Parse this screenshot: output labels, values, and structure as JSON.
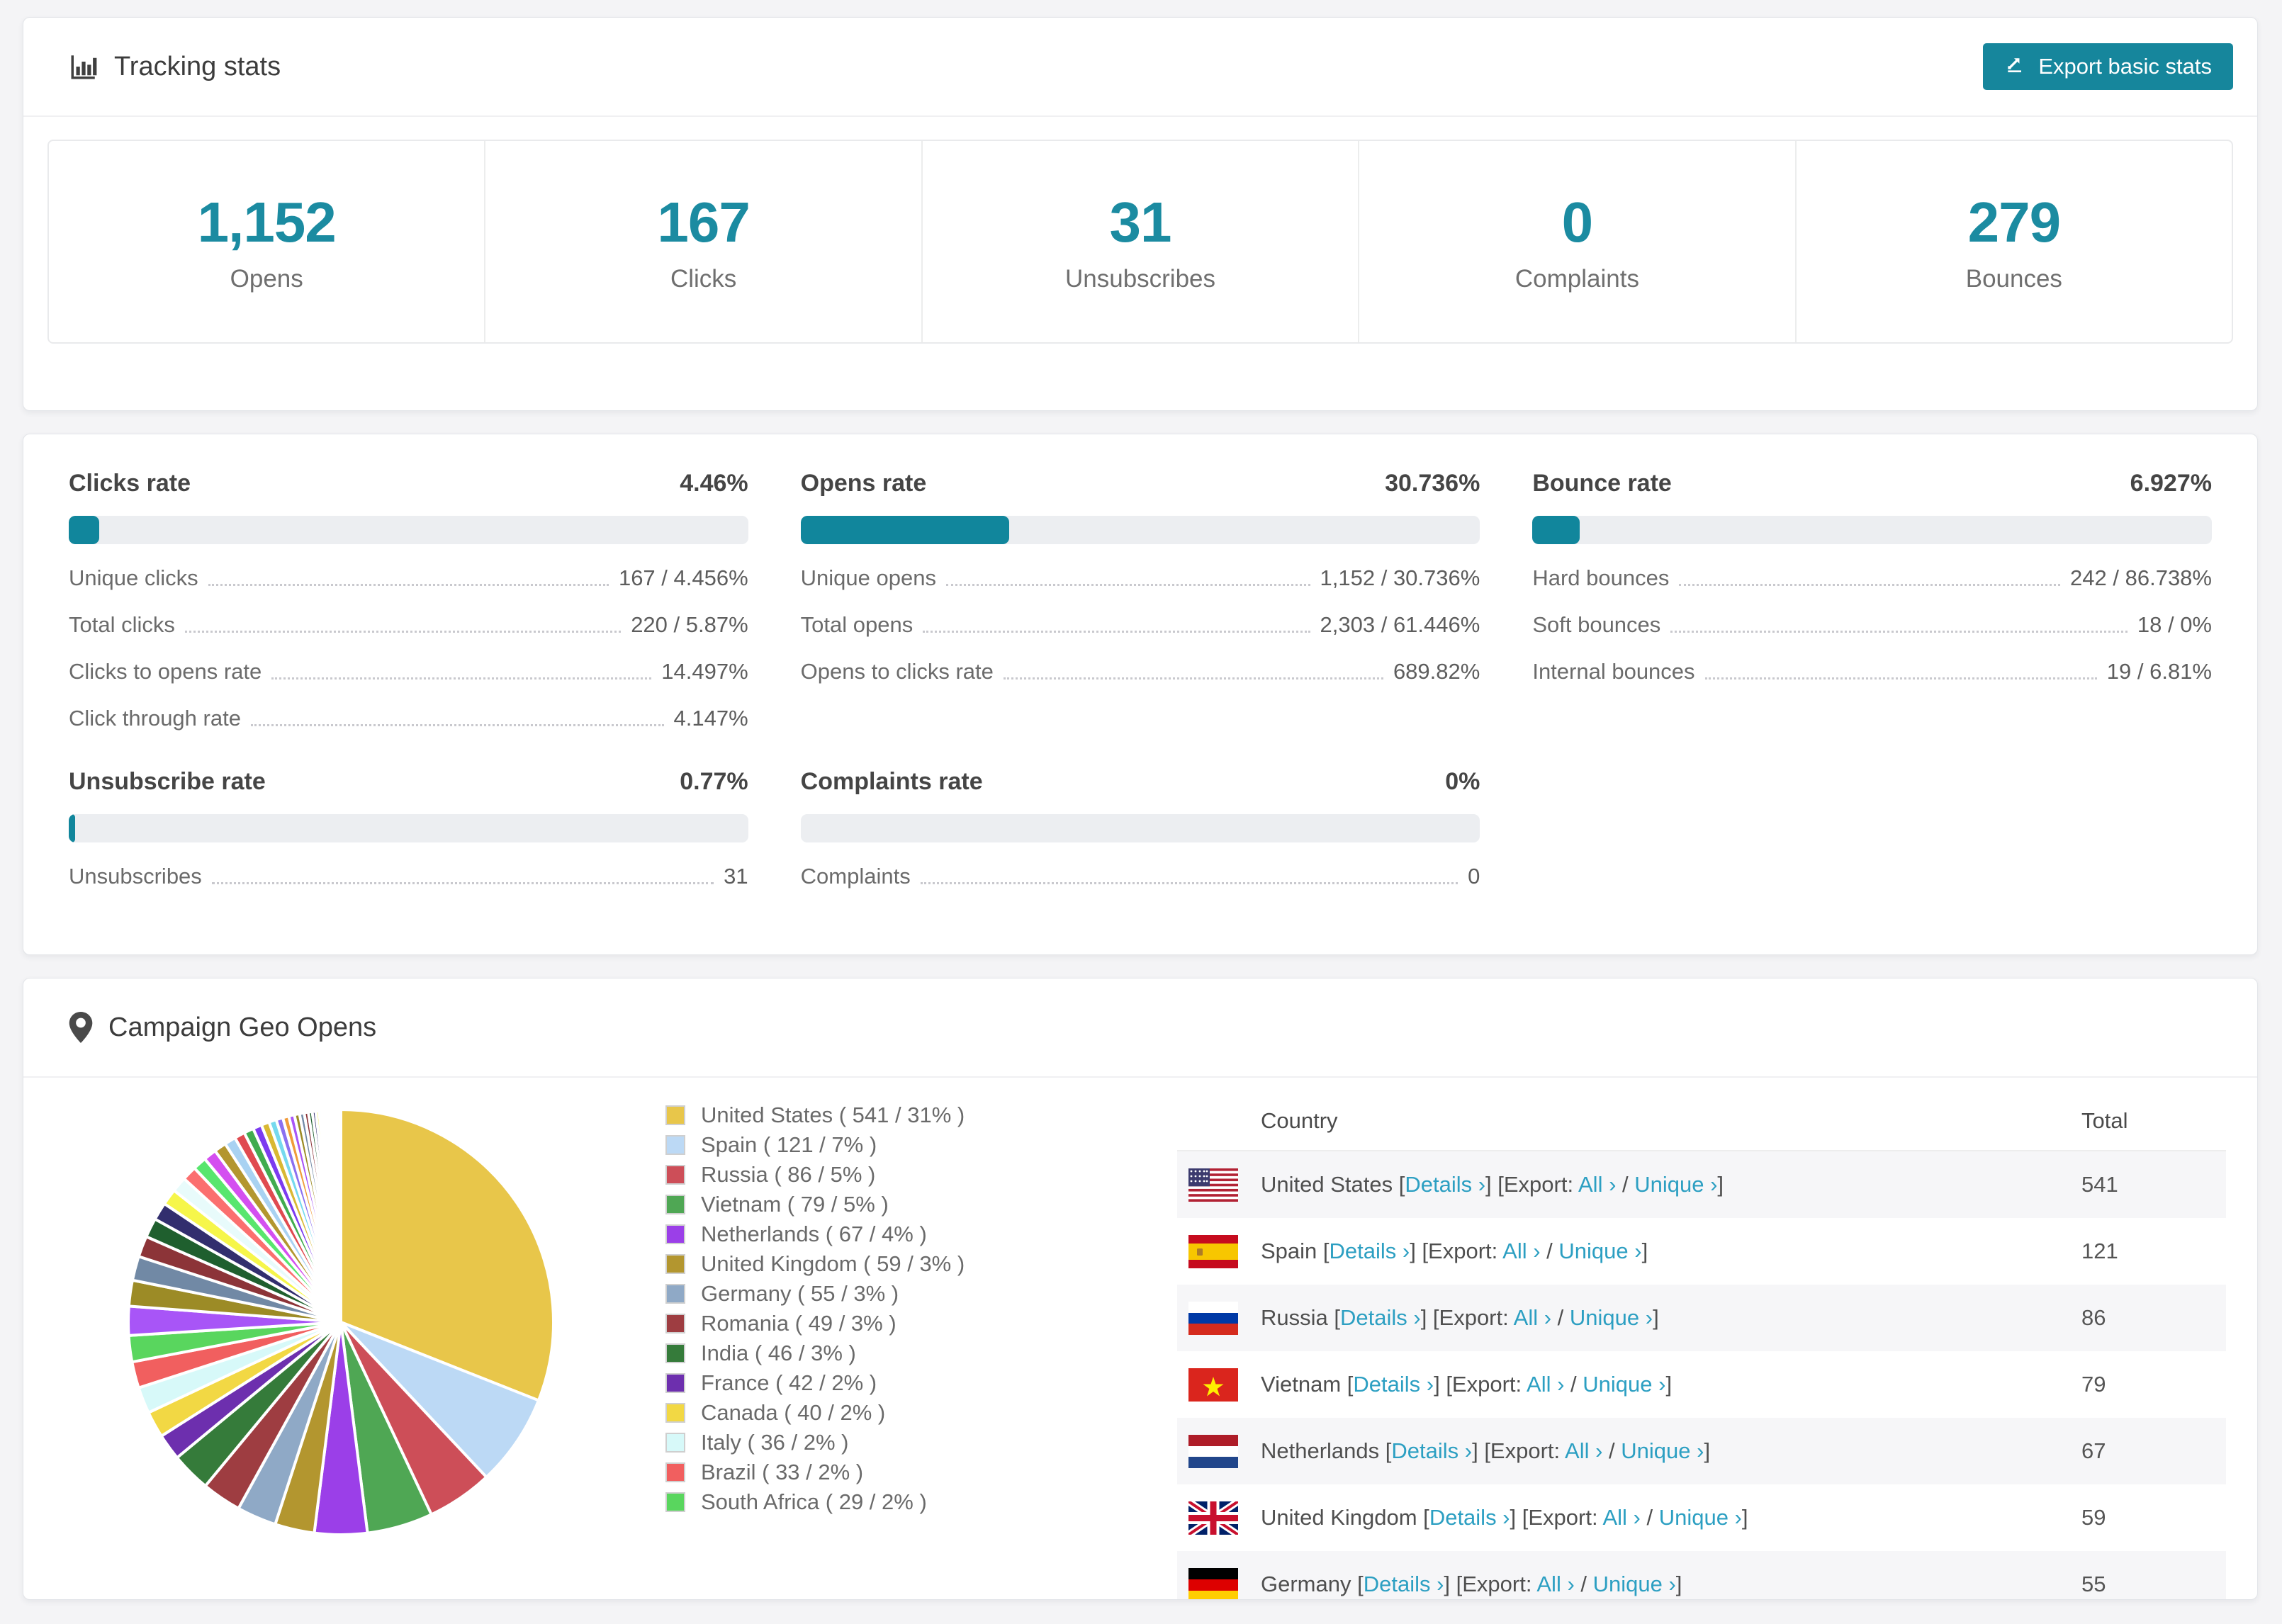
{
  "tracking": {
    "title": "Tracking stats",
    "export_button": "Export basic stats",
    "summary": [
      {
        "value": "1,152",
        "label": "Opens"
      },
      {
        "value": "167",
        "label": "Clicks"
      },
      {
        "value": "31",
        "label": "Unsubscribes"
      },
      {
        "value": "0",
        "label": "Complaints"
      },
      {
        "value": "279",
        "label": "Bounces"
      }
    ]
  },
  "rates": [
    {
      "title": "Clicks rate",
      "value": "4.46%",
      "percent": 4.46,
      "rows": [
        {
          "label": "Unique clicks",
          "value": "167 / 4.456%"
        },
        {
          "label": "Total clicks",
          "value": "220 / 5.87%"
        },
        {
          "label": "Clicks to opens rate",
          "value": "14.497%"
        },
        {
          "label": "Click through rate",
          "value": "4.147%"
        }
      ]
    },
    {
      "title": "Opens rate",
      "value": "30.736%",
      "percent": 30.736,
      "rows": [
        {
          "label": "Unique opens",
          "value": "1,152 / 30.736%"
        },
        {
          "label": "Total opens",
          "value": "2,303 / 61.446%"
        },
        {
          "label": "Opens to clicks rate",
          "value": "689.82%"
        }
      ]
    },
    {
      "title": "Bounce rate",
      "value": "6.927%",
      "percent": 6.927,
      "rows": [
        {
          "label": "Hard bounces",
          "value": "242 / 86.738%"
        },
        {
          "label": "Soft bounces",
          "value": "18 / 0%"
        },
        {
          "label": "Internal bounces",
          "value": "19 / 6.81%"
        }
      ]
    },
    {
      "title": "Unsubscribe rate",
      "value": "0.77%",
      "percent": 0.77,
      "rows": [
        {
          "label": "Unsubscribes",
          "value": "31"
        }
      ]
    },
    {
      "title": "Complaints rate",
      "value": "0%",
      "percent": 0,
      "rows": [
        {
          "label": "Complaints",
          "value": "0"
        }
      ]
    }
  ],
  "geo": {
    "title": "Campaign Geo Opens",
    "table_headers": {
      "country": "Country",
      "total": "Total"
    },
    "tokens": {
      "lb": "[",
      "rb": "]",
      "details": "Details",
      "export_prefix": "Export:",
      "all": "All",
      "unique": "Unique",
      "chevron": "›",
      "slash": "/"
    },
    "rows": [
      {
        "country": "United States",
        "flag": "us",
        "total": "541"
      },
      {
        "country": "Spain",
        "flag": "es",
        "total": "121"
      },
      {
        "country": "Russia",
        "flag": "ru",
        "total": "86"
      },
      {
        "country": "Vietnam",
        "flag": "vn",
        "total": "79"
      },
      {
        "country": "Netherlands",
        "flag": "nl",
        "total": "67"
      },
      {
        "country": "United Kingdom",
        "flag": "gb",
        "total": "59"
      },
      {
        "country": "Germany",
        "flag": "de",
        "total": "55"
      }
    ]
  },
  "chart_data": {
    "type": "pie",
    "title": "Campaign Geo Opens",
    "legend_position": "right",
    "start_angle_deg": -90,
    "direction": "clockwise",
    "slices": [
      {
        "label": "United States",
        "count": 541,
        "percent": 31,
        "color": "#e8c64a"
      },
      {
        "label": "Spain",
        "count": 121,
        "percent": 7,
        "color": "#bcd9f5"
      },
      {
        "label": "Russia",
        "count": 86,
        "percent": 5,
        "color": "#cd4e58"
      },
      {
        "label": "Vietnam",
        "count": 79,
        "percent": 5,
        "color": "#4fa754"
      },
      {
        "label": "Netherlands",
        "count": 67,
        "percent": 4,
        "color": "#9b3fe8"
      },
      {
        "label": "United Kingdom",
        "count": 59,
        "percent": 3,
        "color": "#b3962f"
      },
      {
        "label": "Germany",
        "count": 55,
        "percent": 3,
        "color": "#8fa9c6"
      },
      {
        "label": "Romania",
        "count": 49,
        "percent": 3,
        "color": "#9e3d41"
      },
      {
        "label": "India",
        "count": 46,
        "percent": 3,
        "color": "#357b3a"
      },
      {
        "label": "France",
        "count": 42,
        "percent": 2,
        "color": "#6d2fae"
      },
      {
        "label": "Canada",
        "count": 40,
        "percent": 2,
        "color": "#f2d844"
      },
      {
        "label": "Italy",
        "count": 36,
        "percent": 2,
        "color": "#d7f9f9"
      },
      {
        "label": "Brazil",
        "count": 33,
        "percent": 2,
        "color": "#f15f5f"
      },
      {
        "label": "South Africa",
        "count": 29,
        "percent": 2,
        "color": "#59d65e"
      }
    ],
    "legend_label_format": "{label} ( {count} / {percent}% )",
    "other_slices": {
      "percents": [
        1.8,
        1.6,
        1.5,
        1.3,
        1.2,
        1.1,
        1.0,
        0.95,
        0.9,
        0.85,
        0.8,
        0.75,
        0.7,
        0.65,
        0.6,
        0.55,
        0.5,
        0.46,
        0.42,
        0.38,
        0.35,
        0.32,
        0.29,
        0.26,
        0.24,
        0.22,
        0.2,
        0.18,
        0.16,
        0.14,
        0.13,
        0.12,
        0.11,
        0.1,
        0.09,
        0.08,
        0.07,
        0.06,
        0.05,
        0.05
      ],
      "colors": [
        "#a855f7",
        "#9c8b26",
        "#7189a5",
        "#8c3438",
        "#1f5f2e",
        "#322e6e",
        "#f6f64a",
        "#e8fbfb",
        "#fb6f6f",
        "#58e66e",
        "#d44ff0",
        "#b3962f",
        "#a9d2f2",
        "#e04a50",
        "#41ac4f",
        "#7c3bf0",
        "#d9b832",
        "#76d9ee",
        "#8b6ff0",
        "#f09c3a"
      ]
    }
  }
}
